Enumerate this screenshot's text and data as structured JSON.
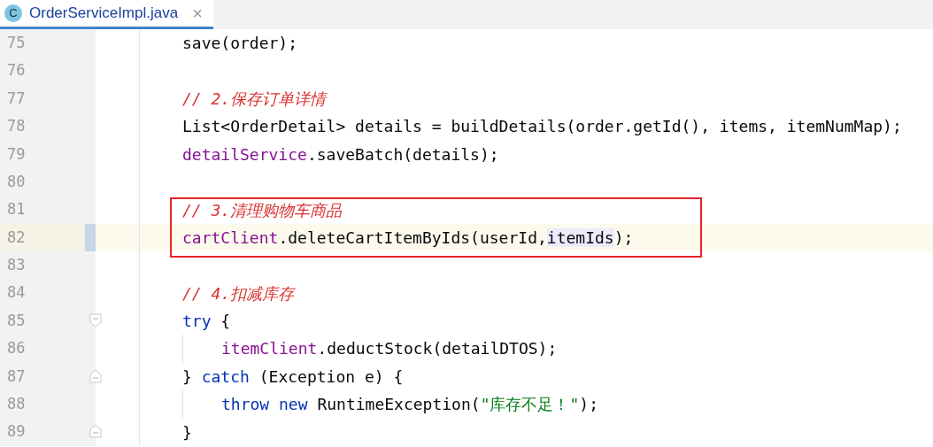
{
  "tab": {
    "icon_letter": "C",
    "title": "OrderServiceImpl.java",
    "close": "×",
    "selected": true
  },
  "lines": [
    {
      "number": "75",
      "nested": false,
      "tokens": [
        {
          "kind": "plain",
          "text": "save(order);"
        }
      ]
    },
    {
      "number": "76"
    },
    {
      "number": "77",
      "nested": false,
      "tokens": [
        {
          "kind": "comment",
          "text": "// 2.保存订单详情"
        }
      ]
    },
    {
      "number": "78",
      "nested": false,
      "tokens": [
        {
          "kind": "plain",
          "text": "List<OrderDetail> details = buildDetails(order.getId(), items, itemNumMap);"
        }
      ]
    },
    {
      "number": "79",
      "nested": false,
      "tokens": [
        {
          "kind": "field",
          "text": "detailService"
        },
        {
          "kind": "plain",
          "text": ".saveBatch(details);"
        }
      ]
    },
    {
      "number": "80"
    },
    {
      "number": "81",
      "boxed": true,
      "nested": false,
      "tokens": [
        {
          "kind": "comment",
          "text": "// 3.清理购物车商品"
        }
      ]
    },
    {
      "number": "82",
      "boxed": true,
      "current": true,
      "nested": false,
      "tokens": [
        {
          "kind": "field",
          "text": "cartClient"
        },
        {
          "kind": "plain",
          "text": ".deleteCartItemByIds(userId,"
        },
        {
          "kind": "highlight",
          "text": "itemIds"
        },
        {
          "kind": "plain",
          "text": ");"
        }
      ]
    },
    {
      "number": "83"
    },
    {
      "number": "84",
      "nested": false,
      "tokens": [
        {
          "kind": "comment",
          "text": "// 4.扣减库存"
        }
      ]
    },
    {
      "number": "85",
      "fold_start": true,
      "nested": false,
      "tokens": [
        {
          "kind": "keyword",
          "text": "try"
        },
        {
          "kind": "plain",
          "text": " {"
        }
      ]
    },
    {
      "number": "86",
      "nested": true,
      "tokens": [
        {
          "kind": "field",
          "text": "itemClient"
        },
        {
          "kind": "plain",
          "text": ".deductStock(detailDTOS);"
        }
      ]
    },
    {
      "number": "87",
      "fold_end": true,
      "nested": false,
      "tokens": [
        {
          "kind": "plain",
          "text": "} "
        },
        {
          "kind": "keyword",
          "text": "catch"
        },
        {
          "kind": "plain",
          "text": " (Exception e) {"
        }
      ]
    },
    {
      "number": "88",
      "nested": true,
      "tokens": [
        {
          "kind": "keyword",
          "text": "throw new"
        },
        {
          "kind": "plain",
          "text": " RuntimeException("
        },
        {
          "kind": "string",
          "text": "\"库存不足！\""
        },
        {
          "kind": "plain",
          "text": ");"
        }
      ]
    },
    {
      "number": "89",
      "fold_end": true,
      "nested": false,
      "tokens": [
        {
          "kind": "plain",
          "text": "}"
        }
      ]
    }
  ]
}
